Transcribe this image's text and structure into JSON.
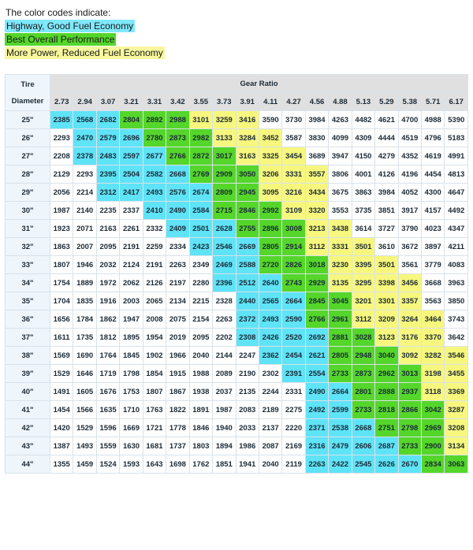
{
  "legend": {
    "title": "The color codes indicate:",
    "items": [
      {
        "label": "Highway, Good Fuel Economy",
        "color": "#7fe8fb"
      },
      {
        "label": "Best Overall Performance",
        "color": "#55d62a"
      },
      {
        "label": "More Power, Reduced Fuel Economy",
        "color": "#f7f79e"
      }
    ]
  },
  "table": {
    "corner_top": "Tire",
    "corner_bottom": "Diameter",
    "gear_ratio_title": "Gear Ratio",
    "ratios": [
      "2.73",
      "2.94",
      "3.07",
      "3.21",
      "3.31",
      "3.42",
      "3.55",
      "3.73",
      "3.91",
      "4.11",
      "4.27",
      "4.56",
      "4.88",
      "5.13",
      "5.29",
      "5.38",
      "5.71",
      "6.17"
    ],
    "rows": [
      {
        "diameter": "25\"",
        "values": [
          2385,
          2568,
          2682,
          2804,
          2892,
          2988,
          3101,
          3259,
          3416,
          3590,
          3730,
          3984,
          4263,
          4482,
          4621,
          4700,
          4988,
          5390
        ],
        "colors": [
          "blue",
          "blue",
          "blue",
          "green",
          "green",
          "green",
          "yellow",
          "yellow",
          "yellow",
          "white",
          "white",
          "white",
          "white",
          "white",
          "white",
          "white",
          "white",
          "white"
        ]
      },
      {
        "diameter": "26\"",
        "values": [
          2293,
          2470,
          2579,
          2696,
          2780,
          2873,
          2982,
          3133,
          3284,
          3452,
          3587,
          3830,
          4099,
          4309,
          4444,
          4519,
          4796,
          5183
        ],
        "colors": [
          "white",
          "blue",
          "blue",
          "blue",
          "green",
          "green",
          "green",
          "yellow",
          "yellow",
          "yellow",
          "white",
          "white",
          "white",
          "white",
          "white",
          "white",
          "white",
          "white"
        ]
      },
      {
        "diameter": "27\"",
        "values": [
          2208,
          2378,
          2483,
          2597,
          2677,
          2766,
          2872,
          3017,
          3163,
          3325,
          3454,
          3689,
          3947,
          4150,
          4279,
          4352,
          4619,
          4991
        ],
        "colors": [
          "white",
          "blue",
          "blue",
          "blue",
          "blue",
          "green",
          "green",
          "green",
          "yellow",
          "yellow",
          "yellow",
          "white",
          "white",
          "white",
          "white",
          "white",
          "white",
          "white"
        ]
      },
      {
        "diameter": "28\"",
        "values": [
          2129,
          2293,
          2395,
          2504,
          2582,
          2668,
          2769,
          2909,
          3050,
          3206,
          3331,
          3557,
          3806,
          4001,
          4126,
          4196,
          4454,
          4813
        ],
        "colors": [
          "white",
          "white",
          "blue",
          "blue",
          "blue",
          "blue",
          "green",
          "green",
          "green",
          "yellow",
          "yellow",
          "yellow",
          "white",
          "white",
          "white",
          "white",
          "white",
          "white"
        ]
      },
      {
        "diameter": "29\"",
        "values": [
          2056,
          2214,
          2312,
          2417,
          2493,
          2576,
          2674,
          2809,
          2945,
          3095,
          3216,
          3434,
          3675,
          3863,
          3984,
          4052,
          4300,
          4647
        ],
        "colors": [
          "white",
          "white",
          "blue",
          "blue",
          "blue",
          "blue",
          "blue",
          "green",
          "green",
          "yellow",
          "yellow",
          "yellow",
          "white",
          "white",
          "white",
          "white",
          "white",
          "white"
        ]
      },
      {
        "diameter": "30\"",
        "values": [
          1987,
          2140,
          2235,
          2337,
          2410,
          2490,
          2584,
          2715,
          2846,
          2992,
          3109,
          3320,
          3553,
          3735,
          3851,
          3917,
          4157,
          4492
        ],
        "colors": [
          "white",
          "white",
          "white",
          "white",
          "blue",
          "blue",
          "blue",
          "green",
          "green",
          "green",
          "yellow",
          "yellow",
          "white",
          "white",
          "white",
          "white",
          "white",
          "white"
        ]
      },
      {
        "diameter": "31\"",
        "values": [
          1923,
          2071,
          2163,
          2261,
          2332,
          2409,
          2501,
          2628,
          2755,
          2896,
          3008,
          3213,
          3438,
          3614,
          3727,
          3790,
          4023,
          4347
        ],
        "colors": [
          "white",
          "white",
          "white",
          "white",
          "white",
          "blue",
          "blue",
          "blue",
          "green",
          "green",
          "green",
          "yellow",
          "yellow",
          "white",
          "white",
          "white",
          "white",
          "white"
        ]
      },
      {
        "diameter": "32\"",
        "values": [
          1863,
          2007,
          2095,
          2191,
          2259,
          2334,
          2423,
          2546,
          2669,
          2805,
          2914,
          3112,
          3331,
          3501,
          3610,
          3672,
          3897,
          4211
        ],
        "colors": [
          "white",
          "white",
          "white",
          "white",
          "white",
          "white",
          "blue",
          "blue",
          "blue",
          "green",
          "green",
          "yellow",
          "yellow",
          "yellow",
          "white",
          "white",
          "white",
          "white"
        ]
      },
      {
        "diameter": "33\"",
        "values": [
          1807,
          1946,
          2032,
          2124,
          2191,
          2263,
          2349,
          2469,
          2588,
          2720,
          2826,
          3018,
          3230,
          3395,
          3501,
          3561,
          3779,
          4083
        ],
        "colors": [
          "white",
          "white",
          "white",
          "white",
          "white",
          "white",
          "white",
          "blue",
          "blue",
          "green",
          "green",
          "green",
          "yellow",
          "yellow",
          "yellow",
          "white",
          "white",
          "white"
        ]
      },
      {
        "diameter": "34\"",
        "values": [
          1754,
          1889,
          1972,
          2062,
          2126,
          2197,
          2280,
          2396,
          2512,
          2640,
          2743,
          2929,
          3135,
          3295,
          3398,
          3456,
          3668,
          3963
        ],
        "colors": [
          "white",
          "white",
          "white",
          "white",
          "white",
          "white",
          "white",
          "blue",
          "blue",
          "blue",
          "green",
          "green",
          "yellow",
          "yellow",
          "yellow",
          "yellow",
          "white",
          "white"
        ]
      },
      {
        "diameter": "35\"",
        "values": [
          1704,
          1835,
          1916,
          2003,
          2065,
          2134,
          2215,
          2328,
          2440,
          2565,
          2664,
          2845,
          3045,
          3201,
          3301,
          3357,
          3563,
          3850
        ],
        "colors": [
          "white",
          "white",
          "white",
          "white",
          "white",
          "white",
          "white",
          "white",
          "blue",
          "blue",
          "blue",
          "green",
          "green",
          "yellow",
          "yellow",
          "yellow",
          "white",
          "white"
        ]
      },
      {
        "diameter": "36\"",
        "values": [
          1656,
          1784,
          1862,
          1947,
          2008,
          2075,
          2154,
          2263,
          2372,
          2493,
          2590,
          2766,
          2961,
          3112,
          3209,
          3264,
          3464,
          3743
        ],
        "colors": [
          "white",
          "white",
          "white",
          "white",
          "white",
          "white",
          "white",
          "white",
          "blue",
          "blue",
          "blue",
          "green",
          "green",
          "yellow",
          "yellow",
          "yellow",
          "yellow",
          "white"
        ]
      },
      {
        "diameter": "37\"",
        "values": [
          1611,
          1735,
          1812,
          1895,
          1954,
          2019,
          2095,
          2202,
          2308,
          2426,
          2520,
          2692,
          2881,
          3028,
          3123,
          3176,
          3370,
          3642
        ],
        "colors": [
          "white",
          "white",
          "white",
          "white",
          "white",
          "white",
          "white",
          "white",
          "blue",
          "blue",
          "blue",
          "blue",
          "green",
          "green",
          "yellow",
          "yellow",
          "yellow",
          "white"
        ]
      },
      {
        "diameter": "38\"",
        "values": [
          1569,
          1690,
          1764,
          1845,
          1902,
          1966,
          2040,
          2144,
          2247,
          2362,
          2454,
          2621,
          2805,
          2948,
          3040,
          3092,
          3282,
          3546
        ],
        "colors": [
          "white",
          "white",
          "white",
          "white",
          "white",
          "white",
          "white",
          "white",
          "white",
          "blue",
          "blue",
          "blue",
          "green",
          "green",
          "green",
          "yellow",
          "yellow",
          "yellow"
        ]
      },
      {
        "diameter": "39\"",
        "values": [
          1529,
          1646,
          1719,
          1798,
          1854,
          1915,
          1988,
          2089,
          2190,
          2302,
          2391,
          2554,
          2733,
          2873,
          2962,
          3013,
          3198,
          3455
        ],
        "colors": [
          "white",
          "white",
          "white",
          "white",
          "white",
          "white",
          "white",
          "white",
          "white",
          "white",
          "blue",
          "blue",
          "green",
          "green",
          "green",
          "green",
          "yellow",
          "yellow"
        ]
      },
      {
        "diameter": "40\"",
        "values": [
          1491,
          1605,
          1676,
          1753,
          1807,
          1867,
          1938,
          2037,
          2135,
          2244,
          2331,
          2490,
          2664,
          2801,
          2888,
          2937,
          3118,
          3369
        ],
        "colors": [
          "white",
          "white",
          "white",
          "white",
          "white",
          "white",
          "white",
          "white",
          "white",
          "white",
          "white",
          "blue",
          "blue",
          "green",
          "green",
          "green",
          "yellow",
          "yellow"
        ]
      },
      {
        "diameter": "41\"",
        "values": [
          1454,
          1566,
          1635,
          1710,
          1763,
          1822,
          1891,
          1987,
          2083,
          2189,
          2275,
          2492,
          2599,
          2733,
          2818,
          2866,
          3042,
          3287
        ],
        "colors": [
          "white",
          "white",
          "white",
          "white",
          "white",
          "white",
          "white",
          "white",
          "white",
          "white",
          "white",
          "blue",
          "blue",
          "green",
          "green",
          "green",
          "green",
          "yellow"
        ]
      },
      {
        "diameter": "42\"",
        "values": [
          1420,
          1529,
          1596,
          1669,
          1721,
          1778,
          1846,
          1940,
          2033,
          2137,
          2220,
          2371,
          2538,
          2668,
          2751,
          2798,
          2969,
          3208
        ],
        "colors": [
          "white",
          "white",
          "white",
          "white",
          "white",
          "white",
          "white",
          "white",
          "white",
          "white",
          "white",
          "blue",
          "blue",
          "blue",
          "green",
          "green",
          "green",
          "yellow"
        ]
      },
      {
        "diameter": "43\"",
        "values": [
          1387,
          1493,
          1559,
          1630,
          1681,
          1737,
          1803,
          1894,
          1986,
          2087,
          2169,
          2316,
          2479,
          2606,
          2687,
          2733,
          2900,
          3134
        ],
        "colors": [
          "white",
          "white",
          "white",
          "white",
          "white",
          "white",
          "white",
          "white",
          "white",
          "white",
          "white",
          "blue",
          "blue",
          "blue",
          "blue",
          "green",
          "green",
          "yellow"
        ]
      },
      {
        "diameter": "44\"",
        "values": [
          1355,
          1459,
          1524,
          1593,
          1643,
          1698,
          1762,
          1851,
          1941,
          2040,
          2119,
          2263,
          2422,
          2545,
          2626,
          2670,
          2834,
          3063
        ],
        "colors": [
          "white",
          "white",
          "white",
          "white",
          "white",
          "white",
          "white",
          "white",
          "white",
          "white",
          "white",
          "blue",
          "blue",
          "blue",
          "blue",
          "blue",
          "green",
          "green"
        ]
      }
    ]
  }
}
